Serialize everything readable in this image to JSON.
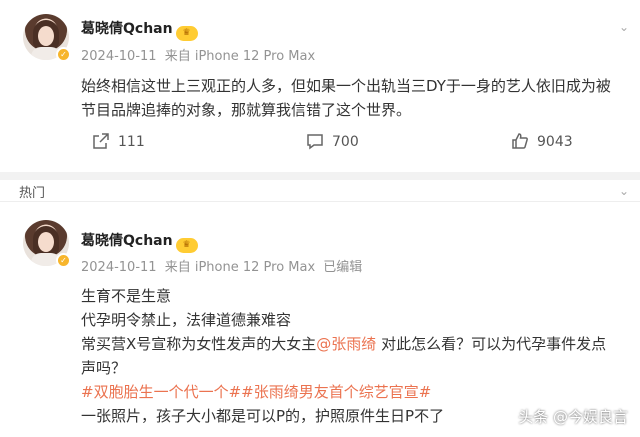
{
  "post1": {
    "author": "葛晓倩Qchan",
    "badge_icon": "crown-badge-icon",
    "date": "2024-10-11",
    "source": "来自 iPhone 12 Pro Max",
    "text_line1": "始终相信这世上三观正的人多，但如果一个出轨当三DY于一身的艺人依旧成为被",
    "text_line2": "节目品牌追捧的对象，那就算我信错了这个世界。",
    "actions": {
      "repost_count": "111",
      "comment_count": "700",
      "like_count": "9043"
    }
  },
  "section": {
    "label": "热门"
  },
  "post2": {
    "author": "葛晓倩Qchan",
    "date": "2024-10-11",
    "source": "来自 iPhone 12 Pro Max",
    "edited": "已编辑",
    "line1": "生育不是生意",
    "line2": "代孕明令禁止，法律道德兼难容",
    "line3_prefix": "常买营X号宣称为女性发声的大女主",
    "line3_mention": "@张雨绮",
    "line3_suffix": " 对此怎么看？可以为代孕事件发点",
    "line4": "声吗？",
    "hashtag1": "#双胞胎生一个代一个#",
    "hashtag2": "#张雨绮男友首个综艺官宣#",
    "line6": "一张照片，孩子大小都是可以P的，护照原件生日P不了"
  },
  "watermark": "头条 @今娱良言",
  "colors": {
    "link": "#eb7350",
    "meta": "#939393",
    "badge": "#ffcc33"
  }
}
